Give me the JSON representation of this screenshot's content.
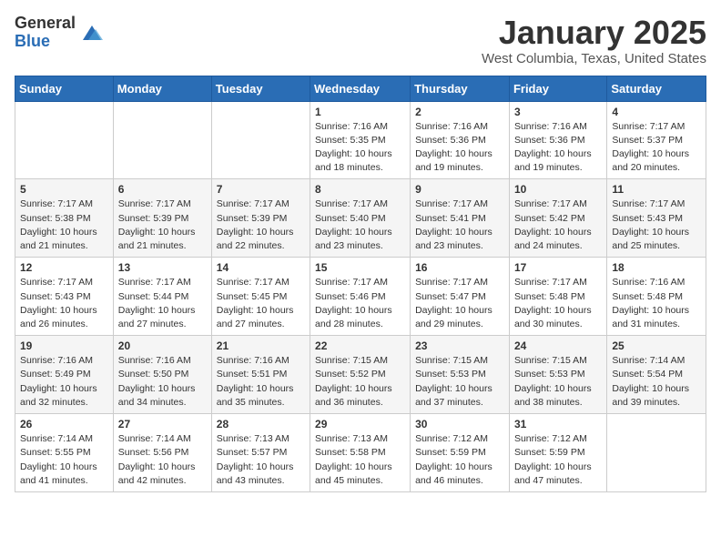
{
  "logo": {
    "general": "General",
    "blue": "Blue"
  },
  "title": "January 2025",
  "location": "West Columbia, Texas, United States",
  "days_of_week": [
    "Sunday",
    "Monday",
    "Tuesday",
    "Wednesday",
    "Thursday",
    "Friday",
    "Saturday"
  ],
  "weeks": [
    [
      {
        "day": "",
        "sunrise": "",
        "sunset": "",
        "daylight": ""
      },
      {
        "day": "",
        "sunrise": "",
        "sunset": "",
        "daylight": ""
      },
      {
        "day": "",
        "sunrise": "",
        "sunset": "",
        "daylight": ""
      },
      {
        "day": "1",
        "sunrise": "Sunrise: 7:16 AM",
        "sunset": "Sunset: 5:35 PM",
        "daylight": "Daylight: 10 hours and 18 minutes."
      },
      {
        "day": "2",
        "sunrise": "Sunrise: 7:16 AM",
        "sunset": "Sunset: 5:36 PM",
        "daylight": "Daylight: 10 hours and 19 minutes."
      },
      {
        "day": "3",
        "sunrise": "Sunrise: 7:16 AM",
        "sunset": "Sunset: 5:36 PM",
        "daylight": "Daylight: 10 hours and 19 minutes."
      },
      {
        "day": "4",
        "sunrise": "Sunrise: 7:17 AM",
        "sunset": "Sunset: 5:37 PM",
        "daylight": "Daylight: 10 hours and 20 minutes."
      }
    ],
    [
      {
        "day": "5",
        "sunrise": "Sunrise: 7:17 AM",
        "sunset": "Sunset: 5:38 PM",
        "daylight": "Daylight: 10 hours and 21 minutes."
      },
      {
        "day": "6",
        "sunrise": "Sunrise: 7:17 AM",
        "sunset": "Sunset: 5:39 PM",
        "daylight": "Daylight: 10 hours and 21 minutes."
      },
      {
        "day": "7",
        "sunrise": "Sunrise: 7:17 AM",
        "sunset": "Sunset: 5:39 PM",
        "daylight": "Daylight: 10 hours and 22 minutes."
      },
      {
        "day": "8",
        "sunrise": "Sunrise: 7:17 AM",
        "sunset": "Sunset: 5:40 PM",
        "daylight": "Daylight: 10 hours and 23 minutes."
      },
      {
        "day": "9",
        "sunrise": "Sunrise: 7:17 AM",
        "sunset": "Sunset: 5:41 PM",
        "daylight": "Daylight: 10 hours and 23 minutes."
      },
      {
        "day": "10",
        "sunrise": "Sunrise: 7:17 AM",
        "sunset": "Sunset: 5:42 PM",
        "daylight": "Daylight: 10 hours and 24 minutes."
      },
      {
        "day": "11",
        "sunrise": "Sunrise: 7:17 AM",
        "sunset": "Sunset: 5:43 PM",
        "daylight": "Daylight: 10 hours and 25 minutes."
      }
    ],
    [
      {
        "day": "12",
        "sunrise": "Sunrise: 7:17 AM",
        "sunset": "Sunset: 5:43 PM",
        "daylight": "Daylight: 10 hours and 26 minutes."
      },
      {
        "day": "13",
        "sunrise": "Sunrise: 7:17 AM",
        "sunset": "Sunset: 5:44 PM",
        "daylight": "Daylight: 10 hours and 27 minutes."
      },
      {
        "day": "14",
        "sunrise": "Sunrise: 7:17 AM",
        "sunset": "Sunset: 5:45 PM",
        "daylight": "Daylight: 10 hours and 27 minutes."
      },
      {
        "day": "15",
        "sunrise": "Sunrise: 7:17 AM",
        "sunset": "Sunset: 5:46 PM",
        "daylight": "Daylight: 10 hours and 28 minutes."
      },
      {
        "day": "16",
        "sunrise": "Sunrise: 7:17 AM",
        "sunset": "Sunset: 5:47 PM",
        "daylight": "Daylight: 10 hours and 29 minutes."
      },
      {
        "day": "17",
        "sunrise": "Sunrise: 7:17 AM",
        "sunset": "Sunset: 5:48 PM",
        "daylight": "Daylight: 10 hours and 30 minutes."
      },
      {
        "day": "18",
        "sunrise": "Sunrise: 7:16 AM",
        "sunset": "Sunset: 5:48 PM",
        "daylight": "Daylight: 10 hours and 31 minutes."
      }
    ],
    [
      {
        "day": "19",
        "sunrise": "Sunrise: 7:16 AM",
        "sunset": "Sunset: 5:49 PM",
        "daylight": "Daylight: 10 hours and 32 minutes."
      },
      {
        "day": "20",
        "sunrise": "Sunrise: 7:16 AM",
        "sunset": "Sunset: 5:50 PM",
        "daylight": "Daylight: 10 hours and 34 minutes."
      },
      {
        "day": "21",
        "sunrise": "Sunrise: 7:16 AM",
        "sunset": "Sunset: 5:51 PM",
        "daylight": "Daylight: 10 hours and 35 minutes."
      },
      {
        "day": "22",
        "sunrise": "Sunrise: 7:15 AM",
        "sunset": "Sunset: 5:52 PM",
        "daylight": "Daylight: 10 hours and 36 minutes."
      },
      {
        "day": "23",
        "sunrise": "Sunrise: 7:15 AM",
        "sunset": "Sunset: 5:53 PM",
        "daylight": "Daylight: 10 hours and 37 minutes."
      },
      {
        "day": "24",
        "sunrise": "Sunrise: 7:15 AM",
        "sunset": "Sunset: 5:53 PM",
        "daylight": "Daylight: 10 hours and 38 minutes."
      },
      {
        "day": "25",
        "sunrise": "Sunrise: 7:14 AM",
        "sunset": "Sunset: 5:54 PM",
        "daylight": "Daylight: 10 hours and 39 minutes."
      }
    ],
    [
      {
        "day": "26",
        "sunrise": "Sunrise: 7:14 AM",
        "sunset": "Sunset: 5:55 PM",
        "daylight": "Daylight: 10 hours and 41 minutes."
      },
      {
        "day": "27",
        "sunrise": "Sunrise: 7:14 AM",
        "sunset": "Sunset: 5:56 PM",
        "daylight": "Daylight: 10 hours and 42 minutes."
      },
      {
        "day": "28",
        "sunrise": "Sunrise: 7:13 AM",
        "sunset": "Sunset: 5:57 PM",
        "daylight": "Daylight: 10 hours and 43 minutes."
      },
      {
        "day": "29",
        "sunrise": "Sunrise: 7:13 AM",
        "sunset": "Sunset: 5:58 PM",
        "daylight": "Daylight: 10 hours and 45 minutes."
      },
      {
        "day": "30",
        "sunrise": "Sunrise: 7:12 AM",
        "sunset": "Sunset: 5:59 PM",
        "daylight": "Daylight: 10 hours and 46 minutes."
      },
      {
        "day": "31",
        "sunrise": "Sunrise: 7:12 AM",
        "sunset": "Sunset: 5:59 PM",
        "daylight": "Daylight: 10 hours and 47 minutes."
      },
      {
        "day": "",
        "sunrise": "",
        "sunset": "",
        "daylight": ""
      }
    ]
  ]
}
